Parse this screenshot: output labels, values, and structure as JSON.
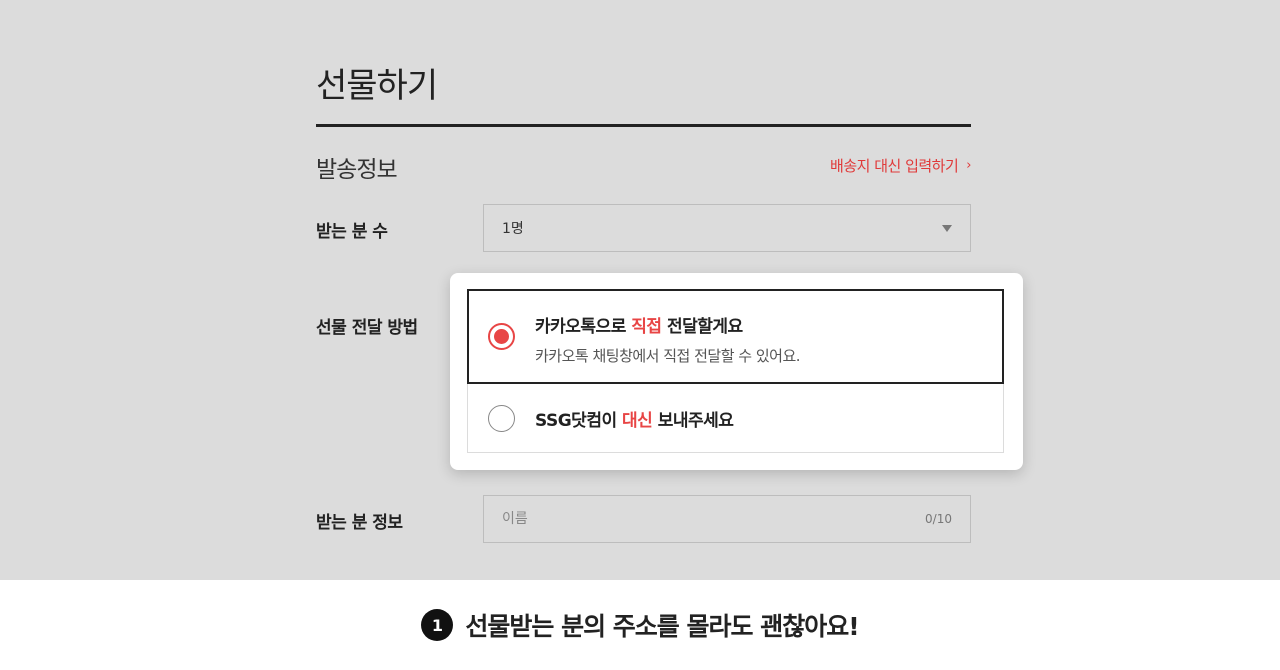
{
  "page": {
    "title": "선물하기"
  },
  "section": {
    "title": "발송정보",
    "alt_link": "배송지 대신 입력하기",
    "alt_link_icon": "chevron-right-icon"
  },
  "recipients": {
    "label": "받는 분 수",
    "value": "1명"
  },
  "method": {
    "label": "선물 전달 방법",
    "options": [
      {
        "title_pre": "카카오톡으로 ",
        "title_hl": "직접",
        "title_post": " 전달할게요",
        "description": "카카오톡 채팅창에서 직접 전달할 수 있어요.",
        "selected": true
      },
      {
        "title_pre": "SSG닷컴이 ",
        "title_hl": "대신",
        "title_post": " 보내주세요",
        "selected": false
      }
    ]
  },
  "recipient_info": {
    "label": "받는 분 정보",
    "placeholder": "이름",
    "counter": "0/10"
  },
  "caption": {
    "badge": "1",
    "text": "선물받는 분의 주소를 몰라도 괜찮아요!"
  },
  "colors": {
    "accent": "#e84545",
    "background": "#dcdcdc"
  }
}
